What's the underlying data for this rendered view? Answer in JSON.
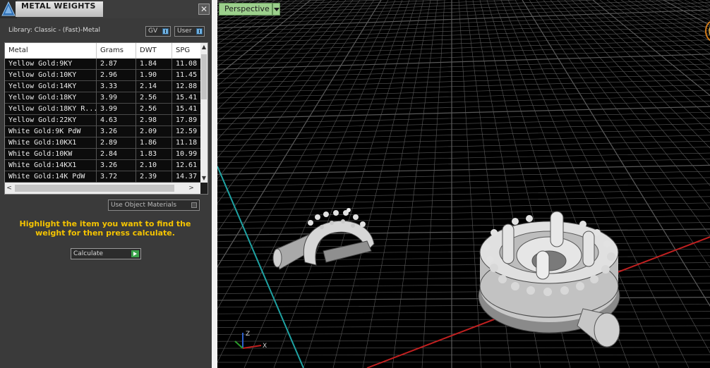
{
  "window": {
    "title": "METAL WEIGHTS",
    "close_label": "✕"
  },
  "library": {
    "label": "Library: Classic - (Fast)-Metal",
    "toggles": [
      {
        "label": "GV"
      },
      {
        "label": "User"
      }
    ]
  },
  "table": {
    "columns": [
      "Metal",
      "Grams",
      "DWT",
      "SPG"
    ],
    "rows": [
      [
        "Yellow Gold:9KY",
        "2.87",
        "1.84",
        "11.08"
      ],
      [
        "Yellow Gold:10KY",
        "2.96",
        "1.90",
        "11.45"
      ],
      [
        "Yellow Gold:14KY",
        "3.33",
        "2.14",
        "12.88"
      ],
      [
        "Yellow Gold:18KY",
        "3.99",
        "2.56",
        "15.41"
      ],
      [
        "Yellow Gold:18KY R...",
        "3.99",
        "2.56",
        "15.41"
      ],
      [
        "Yellow Gold:22KY",
        "4.63",
        "2.98",
        "17.89"
      ],
      [
        "White Gold:9K PdW",
        "3.26",
        "2.09",
        "12.59"
      ],
      [
        "White Gold:10KX1",
        "2.89",
        "1.86",
        "11.18"
      ],
      [
        "White Gold:10KW",
        "2.84",
        "1.83",
        "10.99"
      ],
      [
        "White Gold:14KX1",
        "3.26",
        "2.10",
        "12.61"
      ],
      [
        "White Gold:14K PdW",
        "3.72",
        "2.39",
        "14.37"
      ]
    ],
    "scroll_up": "▲",
    "scroll_down": "▼",
    "scroll_left": "<",
    "scroll_right": ">"
  },
  "options": {
    "use_object_materials": "Use Object Materials"
  },
  "hint": "Highlight the item you want to find the weight for then press calculate.",
  "calculate_label": "Calculate",
  "viewport": {
    "view_label": "Perspective",
    "axis_labels": {
      "x": "X",
      "z": "Z"
    }
  },
  "colors": {
    "accent": "#9ccf8c",
    "hint": "#f5c400",
    "grid": "#5a5a5a",
    "axis_x": "#c02020",
    "axis_y": "#1fa3a3"
  }
}
